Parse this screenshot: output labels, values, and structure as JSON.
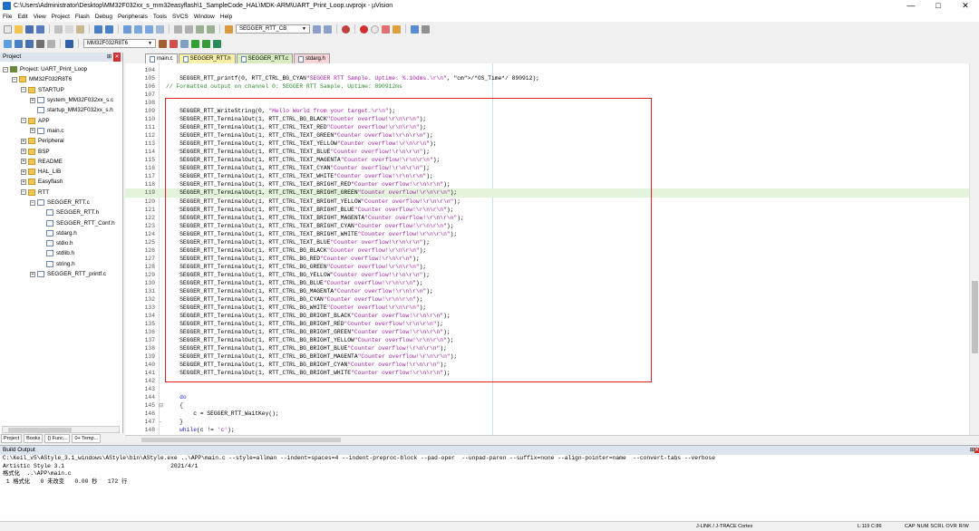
{
  "window": {
    "title": "C:\\Users\\Administrator\\Desktop\\MM32F032xx_s_mm32easyflash\\1_SampleCode_HAL\\MDK-ARM\\UART_Print_Loop.uvprojx - µVision",
    "min": "—",
    "max": "□",
    "close": "✕"
  },
  "menu": [
    "File",
    "Edit",
    "View",
    "Project",
    "Flash",
    "Debug",
    "Peripherals",
    "Tools",
    "SVCS",
    "Window",
    "Help"
  ],
  "toolbar": {
    "find_combo": "SEGGER_RTT_CB",
    "target_combo": "MM32F032R8T6"
  },
  "project": {
    "title": "Project",
    "tree": [
      {
        "label": "Project: UART_Print_Loop",
        "indent": 0,
        "type": "proj",
        "exp": "⊟"
      },
      {
        "label": "MM32F032R8T6",
        "indent": 1,
        "type": "folder",
        "exp": "⊟"
      },
      {
        "label": "STARTUP",
        "indent": 2,
        "type": "folder",
        "exp": "⊟"
      },
      {
        "label": "system_MM32F032xx_s.c",
        "indent": 3,
        "type": "file",
        "exp": "⊞"
      },
      {
        "label": "startup_MM32F032xx_s.h",
        "indent": 3,
        "type": "file",
        "exp": ""
      },
      {
        "label": "APP",
        "indent": 2,
        "type": "folder",
        "exp": "⊟"
      },
      {
        "label": "main.c",
        "indent": 3,
        "type": "file",
        "exp": "⊞"
      },
      {
        "label": "Peripheral",
        "indent": 2,
        "type": "folder",
        "exp": "⊞"
      },
      {
        "label": "BSP",
        "indent": 2,
        "type": "folder",
        "exp": "⊞"
      },
      {
        "label": "README",
        "indent": 2,
        "type": "folder",
        "exp": "⊞"
      },
      {
        "label": "HAL_LIB",
        "indent": 2,
        "type": "folder",
        "exp": "⊞"
      },
      {
        "label": "Easyflash",
        "indent": 2,
        "type": "folder",
        "exp": "⊞"
      },
      {
        "label": "RTT",
        "indent": 2,
        "type": "folder",
        "exp": "⊟"
      },
      {
        "label": "SEGGER_RTT.c",
        "indent": 3,
        "type": "file",
        "exp": "⊟"
      },
      {
        "label": "SEGGER_RTT.h",
        "indent": 4,
        "type": "file",
        "exp": ""
      },
      {
        "label": "SEGGER_RTT_Conf.h",
        "indent": 4,
        "type": "file",
        "exp": ""
      },
      {
        "label": "stdarg.h",
        "indent": 4,
        "type": "file",
        "exp": ""
      },
      {
        "label": "stdio.h",
        "indent": 4,
        "type": "file",
        "exp": ""
      },
      {
        "label": "stdlib.h",
        "indent": 4,
        "type": "file",
        "exp": ""
      },
      {
        "label": "string.h",
        "indent": 4,
        "type": "file",
        "exp": ""
      },
      {
        "label": "SEGGER_RTT_printf.c",
        "indent": 3,
        "type": "file",
        "exp": "⊞"
      }
    ],
    "tabs": [
      "Project",
      "Books",
      "{} Func...",
      "0+ Temp..."
    ]
  },
  "editor_tabs": [
    {
      "label": "main.c",
      "style": "active"
    },
    {
      "label": "SEGGER_RTT.h",
      "style": "yel"
    },
    {
      "label": "SEGGER_RTT.c",
      "style": "grn"
    },
    {
      "label": "stdarg.h",
      "style": "pnk"
    }
  ],
  "code": [
    {
      "n": "104",
      "t": ""
    },
    {
      "n": "105",
      "t": "    SEGGER_RTT_printf(0, RTT_CTRL_BG_CYAN\"SEGGER RTT Sample. Uptime: %.10dms.\\r\\n\", /*OS_Time*/ 890912);"
    },
    {
      "n": "106",
      "t": "// Formatted output on channel 0: SEGGER RTT Sample. Uptime: 890912ms"
    },
    {
      "n": "107",
      "t": ""
    },
    {
      "n": "108",
      "t": ""
    },
    {
      "n": "109",
      "t": "    SEGGER_RTT_WriteString(0, \"Hello World from your target.\\r\\n\");"
    },
    {
      "n": "110",
      "t": "    SEGGER_RTT_TerminalOut(1, RTT_CTRL_BG_BLACK\"Counter overflow!\\r\\n\\r\\n\");"
    },
    {
      "n": "111",
      "t": "    SEGGER_RTT_TerminalOut(1, RTT_CTRL_TEXT_RED\"Counter overflow!\\r\\n\\r\\n\");"
    },
    {
      "n": "112",
      "t": "    SEGGER_RTT_TerminalOut(1, RTT_CTRL_TEXT_GREEN\"Counter overflow!\\r\\n\\r\\n\");"
    },
    {
      "n": "113",
      "t": "    SEGGER_RTT_TerminalOut(1, RTT_CTRL_TEXT_YELLOW\"Counter overflow!\\r\\n\\r\\n\");"
    },
    {
      "n": "114",
      "t": "    SEGGER_RTT_TerminalOut(1, RTT_CTRL_TEXT_BLUE\"Counter overflow!\\r\\n\\r\\n\");"
    },
    {
      "n": "115",
      "t": "    SEGGER_RTT_TerminalOut(1, RTT_CTRL_TEXT_MAGENTA\"Counter overflow!\\r\\n\\r\\n\");"
    },
    {
      "n": "116",
      "t": "    SEGGER_RTT_TerminalOut(1, RTT_CTRL_TEXT_CYAN\"Counter overflow!\\r\\n\\r\\n\");"
    },
    {
      "n": "117",
      "t": "    SEGGER_RTT_TerminalOut(1, RTT_CTRL_TEXT_WHITE\"Counter overflow!\\r\\n\\r\\n\");"
    },
    {
      "n": "118",
      "t": "    SEGGER_RTT_TerminalOut(1, RTT_CTRL_TEXT_BRIGHT_RED\"Counter overflow!\\r\\n\\r\\n\");"
    },
    {
      "n": "119",
      "t": "    SEGGER_RTT_TerminalOut(1, RTT_CTRL_TEXT_BRIGHT_GREEN\"Counter overflow!\\r\\n\\r\\n\");",
      "hl": true
    },
    {
      "n": "120",
      "t": "    SEGGER_RTT_TerminalOut(1, RTT_CTRL_TEXT_BRIGHT_YELLOW\"Counter overflow!\\r\\n\\r\\n\");"
    },
    {
      "n": "121",
      "t": "    SEGGER_RTT_TerminalOut(1, RTT_CTRL_TEXT_BRIGHT_BLUE\"Counter overflow!\\r\\n\\r\\n\");"
    },
    {
      "n": "122",
      "t": "    SEGGER_RTT_TerminalOut(1, RTT_CTRL_TEXT_BRIGHT_MAGENTA\"Counter overflow!\\r\\n\\r\\n\");"
    },
    {
      "n": "123",
      "t": "    SEGGER_RTT_TerminalOut(1, RTT_CTRL_TEXT_BRIGHT_CYAN\"Counter overflow!\\r\\n\\r\\n\");"
    },
    {
      "n": "124",
      "t": "    SEGGER_RTT_TerminalOut(1, RTT_CTRL_TEXT_BRIGHT_WHITE\"Counter overflow!\\r\\n\\r\\n\");"
    },
    {
      "n": "125",
      "t": "    SEGGER_RTT_TerminalOut(1, RTT_CTRL_TEXT_BLUE\"Counter overflow!\\r\\n\\r\\n\");"
    },
    {
      "n": "126",
      "t": "    SEGGER_RTT_TerminalOut(1, RTT_CTRL_BG_BLACK\"Counter overflow!\\r\\n\\r\\n\");"
    },
    {
      "n": "127",
      "t": "    SEGGER_RTT_TerminalOut(1, RTT_CTRL_BG_RED\"Counter overflow!\\r\\n\\r\\n\");"
    },
    {
      "n": "128",
      "t": "    SEGGER_RTT_TerminalOut(1, RTT_CTRL_BG_GREEN\"Counter overflow!\\r\\n\\r\\n\");"
    },
    {
      "n": "129",
      "t": "    SEGGER_RTT_TerminalOut(1, RTT_CTRL_BG_YELLOW\"Counter overflow!\\r\\n\\r\\n\");"
    },
    {
      "n": "130",
      "t": "    SEGGER_RTT_TerminalOut(1, RTT_CTRL_BG_BLUE\"Counter overflow!\\r\\n\\r\\n\");"
    },
    {
      "n": "131",
      "t": "    SEGGER_RTT_TerminalOut(1, RTT_CTRL_BG_MAGENTA\"Counter overflow!\\r\\n\\r\\n\");"
    },
    {
      "n": "132",
      "t": "    SEGGER_RTT_TerminalOut(1, RTT_CTRL_BG_CYAN\"Counter overflow!\\r\\n\\r\\n\");"
    },
    {
      "n": "133",
      "t": "    SEGGER_RTT_TerminalOut(1, RTT_CTRL_BG_WHITE\"Counter overflow!\\r\\n\\r\\n\");"
    },
    {
      "n": "134",
      "t": "    SEGGER_RTT_TerminalOut(1, RTT_CTRL_BG_BRIGHT_BLACK\"Counter overflow!\\r\\n\\r\\n\");"
    },
    {
      "n": "135",
      "t": "    SEGGER_RTT_TerminalOut(1, RTT_CTRL_BG_BRIGHT_RED\"Counter overflow!\\r\\n\\r\\n\");"
    },
    {
      "n": "136",
      "t": "    SEGGER_RTT_TerminalOut(1, RTT_CTRL_BG_BRIGHT_GREEN\"Counter overflow!\\r\\n\\r\\n\");"
    },
    {
      "n": "137",
      "t": "    SEGGER_RTT_TerminalOut(1, RTT_CTRL_BG_BRIGHT_YELLOW\"Counter overflow!\\r\\n\\r\\n\");"
    },
    {
      "n": "138",
      "t": "    SEGGER_RTT_TerminalOut(1, RTT_CTRL_BG_BRIGHT_BLUE\"Counter overflow!\\r\\n\\r\\n\");"
    },
    {
      "n": "139",
      "t": "    SEGGER_RTT_TerminalOut(1, RTT_CTRL_BG_BRIGHT_MAGENTA\"Counter overflow!\\r\\n\\r\\n\");"
    },
    {
      "n": "140",
      "t": "    SEGGER_RTT_TerminalOut(1, RTT_CTRL_BG_BRIGHT_CYAN\"Counter overflow!\\r\\n\\r\\n\");"
    },
    {
      "n": "141",
      "t": "    SEGGER_RTT_TerminalOut(1, RTT_CTRL_BG_BRIGHT_WHITE\"Counter overflow!\\r\\n\\r\\n\");"
    },
    {
      "n": "142",
      "t": ""
    },
    {
      "n": "143",
      "t": ""
    },
    {
      "n": "144",
      "t": "    do"
    },
    {
      "n": "145",
      "t": "    {",
      "fold": "⊟"
    },
    {
      "n": "146",
      "t": "        c = SEGGER_RTT_WaitKey();"
    },
    {
      "n": "147",
      "t": "    }",
      "fold": "-"
    },
    {
      "n": "148",
      "t": "    while(c != 'c');"
    }
  ],
  "build": {
    "title": "Build Output",
    "lines": [
      "C:\\Keil_v5\\AStyle_3.1_windows\\AStyle\\bin\\AStyle.exe ..\\APP\\main.c --style=allman --indent=spaces=4 --indent-preproc-block --pad-oper  --unpad-paren --suffix=none --align-pointer=name  --convert-tabs --verbose",
      "Artistic Style 3.1                               2021/4/1",
      "格式化  ..\\APP\\main.c",
      " 1 格式化   0 未改变   0.00 秒   172 行"
    ]
  },
  "status": {
    "debugger": "J-LINK / J-TRACE Cortex",
    "position": "L:119 C:86",
    "keys": "CAP NUM SCRL OVR R/W"
  }
}
